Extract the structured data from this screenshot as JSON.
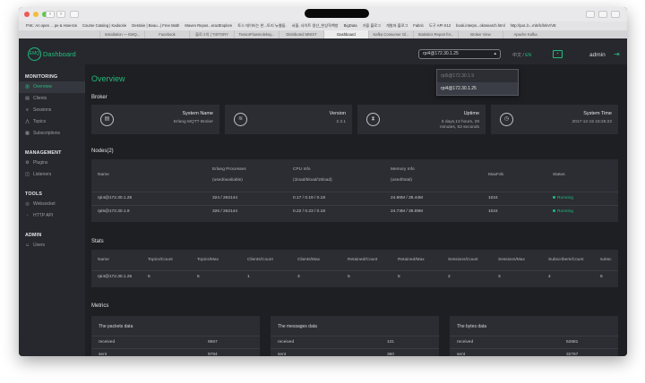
{
  "browser": {
    "bookmarks": [
      "P.W.: An open ... pe & How-tos",
      "Course Catalog | Kadoorie",
      "Destinie | Beau...| Free Math",
      "Maven Repos...eractExplore",
      "토스 데이터는 한...토리 뉴웹들.",
      "서울, 사이트 생산_한상혁책방",
      "BigData",
      "가을 블로그",
      "개발자 블로그",
      "Fabric",
      "도구 API K12",
      "book.interps...okssearch.html",
      "http://par..b...mls/lc/lnkV/VE"
    ],
    "tabs": [
      "Installation — EMQ...",
      "Facebook",
      "블로그의 | TISTORY",
      "TensorFlowmoleksy...",
      "Distributed MNIST",
      "Dashboard",
      "Kafka Consumer Gl...",
      "Statistics Report for...",
      "Broker View",
      "Apache Kafka"
    ],
    "active_tab_index": 5
  },
  "header": {
    "logo_short": "EMQ",
    "logo_text": "Dashboard",
    "node_select_value": "rpi4@172.30.1.25",
    "node_options": [
      "rpi5@172.30.1.9",
      "rpi4@172.30.1.25"
    ],
    "lang_ko": "中文",
    "lang_sep": "/",
    "lang_en": "EN",
    "username": "admin"
  },
  "sidebar": {
    "sections": [
      {
        "title": "MONITORING",
        "items": [
          {
            "label": "Overview",
            "icon": "chart-icon",
            "active": true
          },
          {
            "label": "Clients",
            "icon": "clients-icon"
          },
          {
            "label": "Sessions",
            "icon": "sessions-icon"
          },
          {
            "label": "Topics",
            "icon": "topics-icon"
          },
          {
            "label": "Subscriptions",
            "icon": "subscriptions-icon"
          }
        ]
      },
      {
        "title": "MANAGEMENT",
        "items": [
          {
            "label": "Plugins",
            "icon": "plugins-icon"
          },
          {
            "label": "Listeners",
            "icon": "listeners-icon"
          }
        ]
      },
      {
        "title": "TOOLS",
        "items": [
          {
            "label": "Websocket",
            "icon": "websocket-icon"
          },
          {
            "label": "HTTP API",
            "icon": "api-icon"
          }
        ]
      },
      {
        "title": "ADMIN",
        "items": [
          {
            "label": "Users",
            "icon": "users-icon"
          }
        ]
      }
    ]
  },
  "overview": {
    "title": "Overview",
    "broker_title": "Broker",
    "broker_cards": [
      {
        "label": "System Name",
        "value": "Erlang MQTT Broker",
        "icon": "document-icon"
      },
      {
        "label": "Version",
        "value": "2.3.1",
        "icon": "layers-icon"
      },
      {
        "label": "Uptime",
        "value": "5 days,13 hours, 29 minutes, 53 seconds",
        "icon": "hourglass-icon"
      },
      {
        "label": "System Time",
        "value": "2017-12-15 15:25:22",
        "icon": "clock-icon"
      }
    ],
    "nodes_title": "Nodes(2)",
    "nodes_headers": [
      "Name",
      "Erlang Processes\n(used/avaliable)",
      "CPU Info\n(1load/5load/15load)",
      "Memory Info\n(used/total)",
      "MaxFds",
      "Status"
    ],
    "nodes_rows": [
      [
        "rpi4@172.30.1.25",
        "324 / 262144",
        "0.17 / 0.19 / 0.18",
        "24.86M / 38.44M",
        "1024",
        "Running"
      ],
      [
        "rpi5@172.30.1.9",
        "326 / 262144",
        "0.22 / 0.23 / 0.18",
        "24.73M / 38.69M",
        "1024",
        "Running"
      ]
    ],
    "stats_title": "Stats",
    "stats_headers": [
      "Name",
      "Topics/Count",
      "Topics/Max",
      "Clients/Count",
      "Clients/Max",
      "Retained/Count",
      "Retained/Max",
      "Sessions/Count",
      "Sessions/Max",
      "Subscribers/Count",
      "subsc"
    ],
    "stats_rows": [
      [
        "rpi4@172.30.1.25",
        "5",
        "5",
        "1",
        "3",
        "5",
        "5",
        "2",
        "3",
        "4",
        "5"
      ]
    ],
    "metrics_title": "Metrics",
    "metrics": [
      {
        "title": "The packets data",
        "rows": [
          [
            "received",
            "9567"
          ],
          [
            "sent",
            "9784"
          ]
        ]
      },
      {
        "title": "The messages data",
        "rows": [
          [
            "received",
            "131"
          ],
          [
            "sent",
            "360"
          ]
        ]
      },
      {
        "title": "The bytes data",
        "rows": [
          [
            "received",
            "52681"
          ],
          [
            "sent",
            "32767"
          ]
        ]
      }
    ]
  },
  "colors": {
    "accent": "#22bb7a",
    "sidebar_bg": "#26282e",
    "main_bg": "#1e1f23",
    "card_bg": "#2b2d33"
  }
}
